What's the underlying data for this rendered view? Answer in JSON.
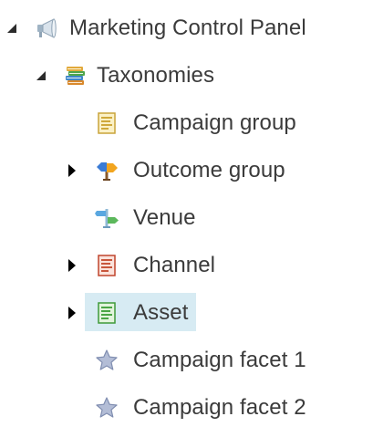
{
  "tree": {
    "root": {
      "label": "Marketing Control Panel",
      "icon": "megaphone-icon",
      "state": "expanded"
    },
    "taxonomies": {
      "label": "Taxonomies",
      "icon": "books-icon",
      "state": "expanded",
      "children": [
        {
          "label": "Campaign group",
          "icon": "yellow-document-icon",
          "state": "leaf"
        },
        {
          "label": "Outcome group",
          "icon": "signpost-icon",
          "state": "collapsed"
        },
        {
          "label": "Venue",
          "icon": "venue-signpost-icon",
          "state": "leaf"
        },
        {
          "label": "Channel",
          "icon": "red-document-icon",
          "state": "collapsed"
        },
        {
          "label": "Asset",
          "icon": "green-document-icon",
          "state": "collapsed",
          "selected": true
        },
        {
          "label": "Campaign facet 1",
          "icon": "star-icon",
          "state": "leaf"
        },
        {
          "label": "Campaign facet 2",
          "icon": "star-icon",
          "state": "leaf"
        }
      ]
    }
  },
  "colors": {
    "text": "#3b3b3b",
    "selection_bg": "#d7ebf3",
    "expanded_arrow": "#2b2b2b",
    "collapsed_arrow": "#000000"
  }
}
